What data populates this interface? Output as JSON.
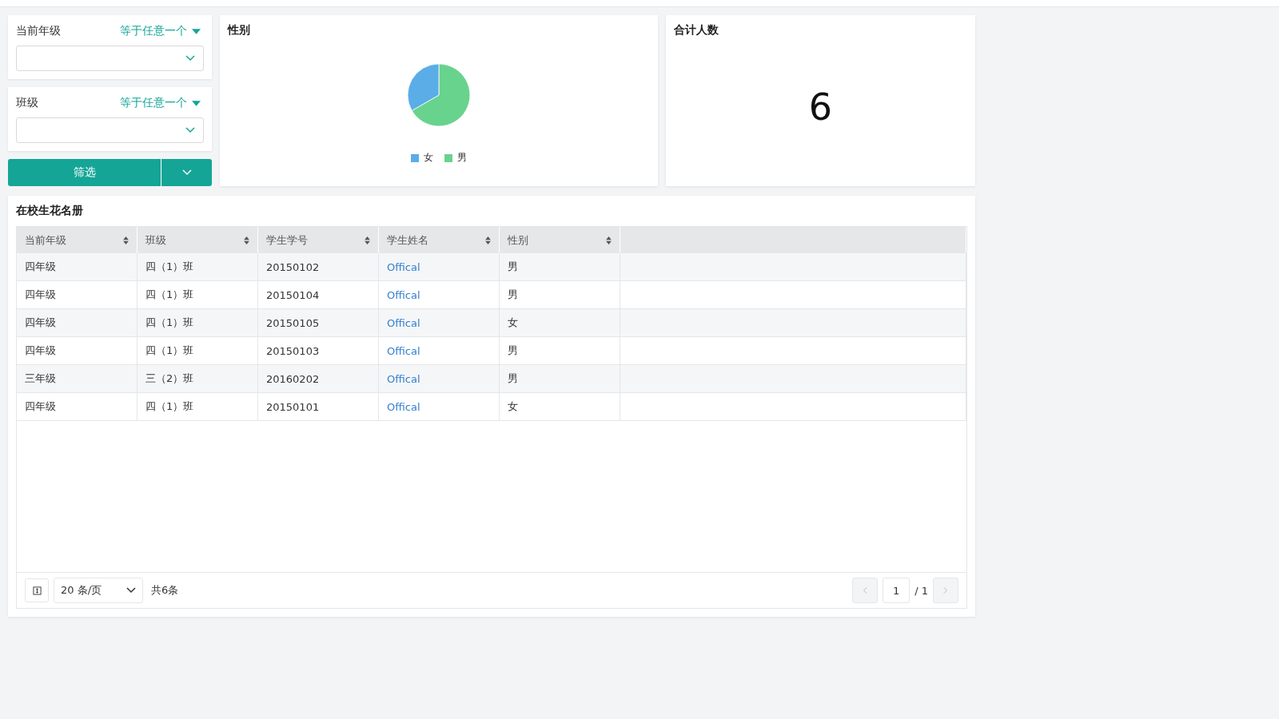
{
  "filters": [
    {
      "label": "当前年级",
      "operator": "等于任意一个"
    },
    {
      "label": "班级",
      "operator": "等于任意一个"
    }
  ],
  "filter_button": {
    "label": "筛选"
  },
  "gender_chart": {
    "title": "性别",
    "legend": [
      {
        "label": "女",
        "color": "#5aade6"
      },
      {
        "label": "男",
        "color": "#68d38d"
      }
    ]
  },
  "total": {
    "title": "合计人数",
    "value": "6"
  },
  "roster": {
    "title": "在校生花名册",
    "columns": [
      "当前年级",
      "班级",
      "学生学号",
      "学生姓名",
      "性别"
    ],
    "rows": [
      [
        "四年级",
        "四（1）班",
        "20150102",
        "Offical",
        "男"
      ],
      [
        "四年级",
        "四（1）班",
        "20150104",
        "Offical",
        "男"
      ],
      [
        "四年级",
        "四（1）班",
        "20150105",
        "Offical",
        "女"
      ],
      [
        "四年级",
        "四（1）班",
        "20150103",
        "Offical",
        "男"
      ],
      [
        "三年级",
        "三（2）班",
        "20160202",
        "Offical",
        "男"
      ],
      [
        "四年级",
        "四（1）班",
        "20150101",
        "Offical",
        "女"
      ]
    ],
    "page_size": "20 条/页",
    "total_text": "共6条",
    "page": "1",
    "page_total": "/ 1"
  }
}
